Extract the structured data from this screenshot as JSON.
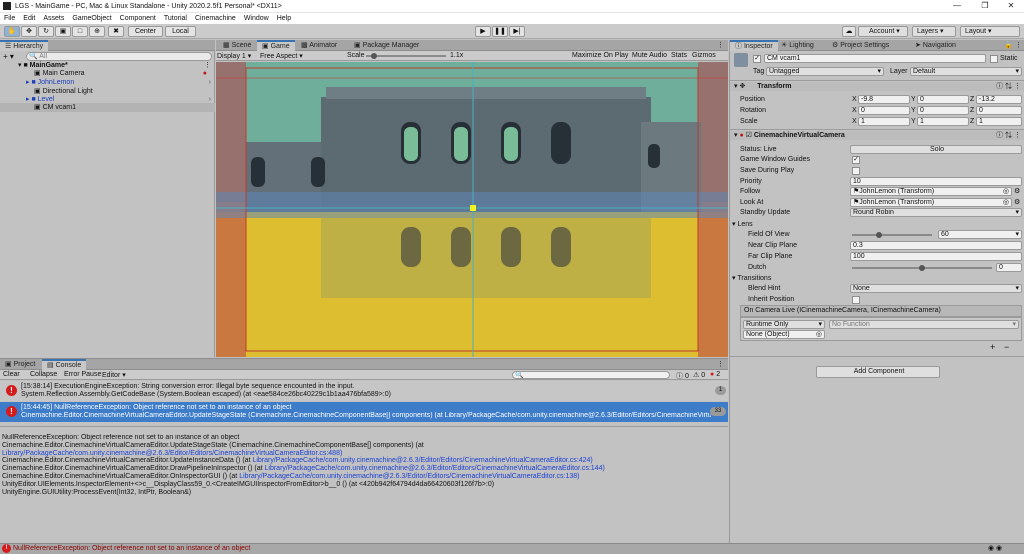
{
  "title": "LGS - MainGame - PC, Mac & Linux Standalone - Unity 2020.2.5f1 Personal* <DX11>",
  "menu": [
    "File",
    "Edit",
    "Assets",
    "GameObject",
    "Component",
    "Tutorial",
    "Cinemachine",
    "Window",
    "Help"
  ],
  "toolbar": {
    "center": "Center",
    "local": "Local",
    "account": "Account",
    "layers": "Layers",
    "layout": "Layout"
  },
  "hierarchy": {
    "tab": "Hierarchy",
    "search_placeholder": "All",
    "items": [
      "MainGame*",
      "Main Camera",
      "JohnLemon",
      "Directional Light",
      "Level",
      "CM vcam1"
    ]
  },
  "game_view": {
    "tabs": [
      "Scene",
      "Game",
      "Animator",
      "Package Manager"
    ],
    "display": "Display 1",
    "aspect": "Free Aspect",
    "scale_label": "Scale",
    "scale_value": "1.1x",
    "buttons": [
      "Maximize On Play",
      "Mute Audio",
      "Stats",
      "Gizmos"
    ]
  },
  "inspector": {
    "tabs": [
      "Inspector",
      "Lighting",
      "Project Settings",
      "Navigation"
    ],
    "object_name": "CM vcam1",
    "static_label": "Static",
    "tag_label": "Tag",
    "tag_value": "Untagged",
    "layer_label": "Layer",
    "layer_value": "Default",
    "transform": {
      "header": "Transform",
      "position_label": "Position",
      "position": [
        "-9.8",
        "0",
        "-13.2"
      ],
      "rotation_label": "Rotation",
      "rotation": [
        "0",
        "0",
        "0"
      ],
      "scale_label": "Scale",
      "scale": [
        "1",
        "1",
        "1"
      ]
    },
    "cm": {
      "header": "CinemachineVirtualCamera",
      "status_label": "Status: Live",
      "solo": "Solo",
      "game_window_guides": "Game Window Guides",
      "save_during_play": "Save During Play",
      "priority_label": "Priority",
      "priority": "10",
      "follow_label": "Follow",
      "follow": "JohnLemon (Transform)",
      "lookat_label": "Look At",
      "lookat": "JohnLemon (Transform)",
      "standby_label": "Standby Update",
      "standby": "Round Robin",
      "lens": "Lens",
      "fov_label": "Field Of View",
      "fov": "60",
      "near_label": "Near Clip Plane",
      "near": "0.3",
      "far_label": "Far Clip Plane",
      "far": "100",
      "dutch_label": "Dutch",
      "dutch": "0",
      "transitions": "Transitions",
      "blend_label": "Blend Hint",
      "blend": "None",
      "inherit_label": "Inherit Position",
      "event_header": "On Camera Live (ICinemachineCamera, ICinemachineCamera)",
      "runtime": "Runtime Only",
      "no_function": "No Function",
      "none_object": "None (Object)"
    },
    "add_component": "Add Component"
  },
  "console": {
    "tabs": [
      "Project",
      "Console"
    ],
    "buttons": [
      "Clear",
      "Collapse",
      "Error Pause",
      "Editor"
    ],
    "counts": [
      "0",
      "0",
      "2"
    ],
    "entries": [
      {
        "line1": "[15:38:14] ExecutionEngineException: String conversion error: Illegal byte sequence encounted in the input.",
        "line2": "System.Reflection.Assembly.GetCodeBase (System.Boolean escaped) (at <eae584ce26bc40229c1b1aa476bfa589>:0)",
        "count": "1"
      },
      {
        "line1": "[15:44:45] NullReferenceException: Object reference not set to an instance of an object",
        "line2": "Cinemachine.Editor.CinemachineVirtualCameraEditor.UpdateStageState (Cinemachine.CinemachineComponentBase[] components) (at Library/PackageCache/com.unity.cinemachine@2.6.3/Editor/Editors/CinemachineVirtualCamera...",
        "count": "33"
      }
    ],
    "detail": [
      {
        "text": "NullReferenceException: Object reference not set to an instance of an object"
      },
      {
        "text": "Cinemachine.Editor.CinemachineVirtualCameraEditor.UpdateStageState (Cinemachine.CinemachineComponentBase[] components) (at"
      },
      {
        "link": "Library/PackageCache/com.unity.cinemachine@2.6.3/Editor/Editors/CinemachineVirtualCameraEditor.cs:488)"
      },
      {
        "text": "Cinemachine.Editor.CinemachineVirtualCameraEditor.UpdateInstanceData () (at ",
        "link": "Library/PackageCache/com.unity.cinemachine@2.6.3/Editor/Editors/CinemachineVirtualCameraEditor.cs:424)"
      },
      {
        "text": "Cinemachine.Editor.CinemachineVirtualCameraEditor.DrawPipelineInInspector () (at ",
        "link": "Library/PackageCache/com.unity.cinemachine@2.6.3/Editor/Editors/CinemachineVirtualCameraEditor.cs:144)"
      },
      {
        "text": "Cinemachine.Editor.CinemachineVirtualCameraEditor.OnInspectorGUI () (at ",
        "link": "Library/PackageCache/com.unity.cinemachine@2.6.3/Editor/Editors/CinemachineVirtualCameraEditor.cs:138)"
      },
      {
        "text": "UnityEditor.UIElements.InspectorElement+<>c__DisplayClass59_0.<CreateIMGUIInspectorFromEditor>b__0 () (at <420b942f64794d4da66420603f126f7b>:0)"
      },
      {
        "text": "UnityEngine.GUIUtility:ProcessEvent(Int32, IntPtr, Boolean&)"
      }
    ]
  },
  "status_message": "NullReferenceException: Object reference not set to an instance of an object",
  "colors": {
    "accent": "#3d7cc9",
    "error": "#d51c1c",
    "link": "#1a3fd2"
  }
}
